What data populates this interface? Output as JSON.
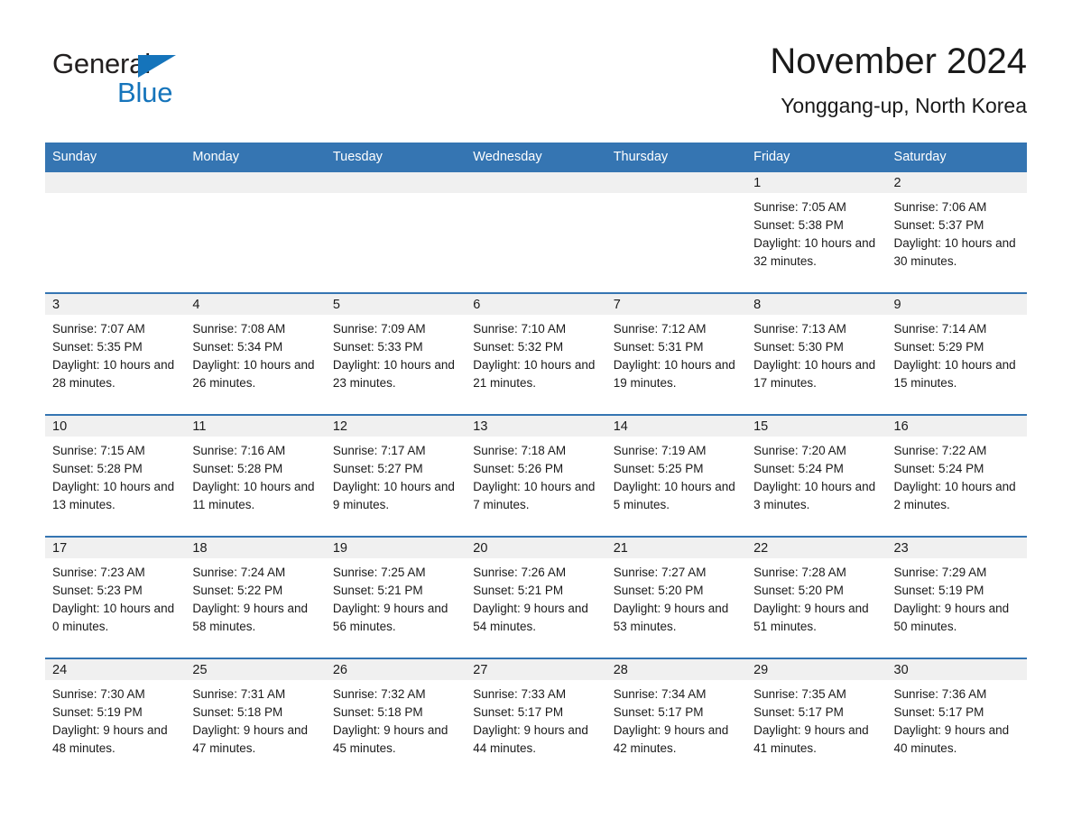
{
  "brand": {
    "name_part1": "General",
    "name_part2": "Blue",
    "triangle_icon": "triangle-icon",
    "accent_color": "#1574bb"
  },
  "header": {
    "title": "November 2024",
    "subtitle": "Yonggang-up, North Korea"
  },
  "calendar": {
    "header_bg": "#3575b2",
    "date_strip_bg": "#f0f0f0",
    "weekdays": [
      "Sunday",
      "Monday",
      "Tuesday",
      "Wednesday",
      "Thursday",
      "Friday",
      "Saturday"
    ],
    "weeks": [
      [
        {
          "day": ""
        },
        {
          "day": ""
        },
        {
          "day": ""
        },
        {
          "day": ""
        },
        {
          "day": ""
        },
        {
          "day": "1",
          "sunrise": "Sunrise: 7:05 AM",
          "sunset": "Sunset: 5:38 PM",
          "daylight": "Daylight: 10 hours and 32 minutes."
        },
        {
          "day": "2",
          "sunrise": "Sunrise: 7:06 AM",
          "sunset": "Sunset: 5:37 PM",
          "daylight": "Daylight: 10 hours and 30 minutes."
        }
      ],
      [
        {
          "day": "3",
          "sunrise": "Sunrise: 7:07 AM",
          "sunset": "Sunset: 5:35 PM",
          "daylight": "Daylight: 10 hours and 28 minutes."
        },
        {
          "day": "4",
          "sunrise": "Sunrise: 7:08 AM",
          "sunset": "Sunset: 5:34 PM",
          "daylight": "Daylight: 10 hours and 26 minutes."
        },
        {
          "day": "5",
          "sunrise": "Sunrise: 7:09 AM",
          "sunset": "Sunset: 5:33 PM",
          "daylight": "Daylight: 10 hours and 23 minutes."
        },
        {
          "day": "6",
          "sunrise": "Sunrise: 7:10 AM",
          "sunset": "Sunset: 5:32 PM",
          "daylight": "Daylight: 10 hours and 21 minutes."
        },
        {
          "day": "7",
          "sunrise": "Sunrise: 7:12 AM",
          "sunset": "Sunset: 5:31 PM",
          "daylight": "Daylight: 10 hours and 19 minutes."
        },
        {
          "day": "8",
          "sunrise": "Sunrise: 7:13 AM",
          "sunset": "Sunset: 5:30 PM",
          "daylight": "Daylight: 10 hours and 17 minutes."
        },
        {
          "day": "9",
          "sunrise": "Sunrise: 7:14 AM",
          "sunset": "Sunset: 5:29 PM",
          "daylight": "Daylight: 10 hours and 15 minutes."
        }
      ],
      [
        {
          "day": "10",
          "sunrise": "Sunrise: 7:15 AM",
          "sunset": "Sunset: 5:28 PM",
          "daylight": "Daylight: 10 hours and 13 minutes."
        },
        {
          "day": "11",
          "sunrise": "Sunrise: 7:16 AM",
          "sunset": "Sunset: 5:28 PM",
          "daylight": "Daylight: 10 hours and 11 minutes."
        },
        {
          "day": "12",
          "sunrise": "Sunrise: 7:17 AM",
          "sunset": "Sunset: 5:27 PM",
          "daylight": "Daylight: 10 hours and 9 minutes."
        },
        {
          "day": "13",
          "sunrise": "Sunrise: 7:18 AM",
          "sunset": "Sunset: 5:26 PM",
          "daylight": "Daylight: 10 hours and 7 minutes."
        },
        {
          "day": "14",
          "sunrise": "Sunrise: 7:19 AM",
          "sunset": "Sunset: 5:25 PM",
          "daylight": "Daylight: 10 hours and 5 minutes."
        },
        {
          "day": "15",
          "sunrise": "Sunrise: 7:20 AM",
          "sunset": "Sunset: 5:24 PM",
          "daylight": "Daylight: 10 hours and 3 minutes."
        },
        {
          "day": "16",
          "sunrise": "Sunrise: 7:22 AM",
          "sunset": "Sunset: 5:24 PM",
          "daylight": "Daylight: 10 hours and 2 minutes."
        }
      ],
      [
        {
          "day": "17",
          "sunrise": "Sunrise: 7:23 AM",
          "sunset": "Sunset: 5:23 PM",
          "daylight": "Daylight: 10 hours and 0 minutes."
        },
        {
          "day": "18",
          "sunrise": "Sunrise: 7:24 AM",
          "sunset": "Sunset: 5:22 PM",
          "daylight": "Daylight: 9 hours and 58 minutes."
        },
        {
          "day": "19",
          "sunrise": "Sunrise: 7:25 AM",
          "sunset": "Sunset: 5:21 PM",
          "daylight": "Daylight: 9 hours and 56 minutes."
        },
        {
          "day": "20",
          "sunrise": "Sunrise: 7:26 AM",
          "sunset": "Sunset: 5:21 PM",
          "daylight": "Daylight: 9 hours and 54 minutes."
        },
        {
          "day": "21",
          "sunrise": "Sunrise: 7:27 AM",
          "sunset": "Sunset: 5:20 PM",
          "daylight": "Daylight: 9 hours and 53 minutes."
        },
        {
          "day": "22",
          "sunrise": "Sunrise: 7:28 AM",
          "sunset": "Sunset: 5:20 PM",
          "daylight": "Daylight: 9 hours and 51 minutes."
        },
        {
          "day": "23",
          "sunrise": "Sunrise: 7:29 AM",
          "sunset": "Sunset: 5:19 PM",
          "daylight": "Daylight: 9 hours and 50 minutes."
        }
      ],
      [
        {
          "day": "24",
          "sunrise": "Sunrise: 7:30 AM",
          "sunset": "Sunset: 5:19 PM",
          "daylight": "Daylight: 9 hours and 48 minutes."
        },
        {
          "day": "25",
          "sunrise": "Sunrise: 7:31 AM",
          "sunset": "Sunset: 5:18 PM",
          "daylight": "Daylight: 9 hours and 47 minutes."
        },
        {
          "day": "26",
          "sunrise": "Sunrise: 7:32 AM",
          "sunset": "Sunset: 5:18 PM",
          "daylight": "Daylight: 9 hours and 45 minutes."
        },
        {
          "day": "27",
          "sunrise": "Sunrise: 7:33 AM",
          "sunset": "Sunset: 5:17 PM",
          "daylight": "Daylight: 9 hours and 44 minutes."
        },
        {
          "day": "28",
          "sunrise": "Sunrise: 7:34 AM",
          "sunset": "Sunset: 5:17 PM",
          "daylight": "Daylight: 9 hours and 42 minutes."
        },
        {
          "day": "29",
          "sunrise": "Sunrise: 7:35 AM",
          "sunset": "Sunset: 5:17 PM",
          "daylight": "Daylight: 9 hours and 41 minutes."
        },
        {
          "day": "30",
          "sunrise": "Sunrise: 7:36 AM",
          "sunset": "Sunset: 5:17 PM",
          "daylight": "Daylight: 9 hours and 40 minutes."
        }
      ]
    ]
  }
}
